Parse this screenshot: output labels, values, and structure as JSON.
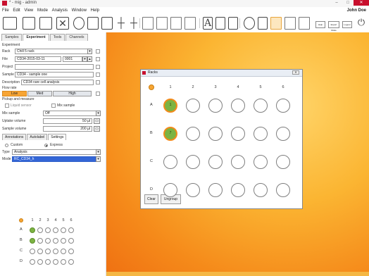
{
  "window": {
    "title": "* - mig - admin",
    "minimize": "–",
    "maximize": "□",
    "close": "✕"
  },
  "menu": [
    "File",
    "Edit",
    "View",
    "Mode",
    "Analysis",
    "Window",
    "Help"
  ],
  "user": "John Doe",
  "toolbar": {
    "help": "Help",
    "expert_mode": "Expert Mode",
    "logout": "Logout"
  },
  "tabs": [
    "Samples",
    "Experiment",
    "Tools",
    "Channels"
  ],
  "experiment": {
    "section_label": "Experiment",
    "rack_label": "Rack",
    "rack_value": "Chill 5 rack",
    "file_label": "File",
    "file_value": "CD34-2015-03-11",
    "file_number": "0001",
    "project_label": "Project",
    "project_value": "",
    "sample_id_label": "Sample ID",
    "sample_id_value": "CD34 - sample one",
    "description_label": "Description",
    "description_value": "CD34 rare cell analysis"
  },
  "flow_rate": {
    "label": "Flow rate",
    "options": [
      "Low",
      "Med",
      "High"
    ],
    "selected": "Low"
  },
  "pickup": {
    "section_label": "Pickup and measure",
    "liquid_sensor": "Liquid sensor",
    "mix_sample": "Mix sample",
    "mix_speed_label": "Mix sample",
    "mix_speed_value": "Off",
    "uptake_label": "Uptake volume",
    "uptake_value": "50 µl",
    "sample_volume_label": "Sample volume",
    "sample_volume_value": "200 µl"
  },
  "subtabs": [
    "Annotations",
    "Autolabel",
    "Settings"
  ],
  "settings": {
    "custom": "Custom",
    "express": "Express",
    "type_label": "Type",
    "type_value": "Analysis",
    "mode_label": "Mode",
    "mode_value": "RC_CD34_h"
  },
  "plate": {
    "columns": [
      "1",
      "2",
      "3",
      "4",
      "5",
      "6"
    ],
    "rows": [
      "A",
      "B",
      "C",
      "D"
    ],
    "filled": [
      [
        true,
        false,
        false,
        false,
        false,
        false
      ],
      [
        true,
        false,
        false,
        false,
        false,
        false
      ],
      [
        false,
        false,
        false,
        false,
        false,
        false
      ],
      [
        false,
        false,
        false,
        false,
        false,
        false
      ]
    ],
    "well_labels": [
      [
        "1",
        "",
        "",
        "",
        "",
        ""
      ],
      [
        "7",
        "",
        "",
        "",
        "",
        ""
      ],
      [
        "",
        "",
        "",
        "",
        "",
        ""
      ],
      [
        "",
        "",
        "",
        "",
        "",
        ""
      ]
    ]
  },
  "racks_dialog": {
    "title": "Racks",
    "clear_label": "Clear",
    "ungroup_label": "Ungroup"
  },
  "colors": {
    "accent": "#f7a534",
    "filled_well": "#7cb342",
    "filled_ring": "#f28a1a",
    "selection": "#3466d6"
  }
}
